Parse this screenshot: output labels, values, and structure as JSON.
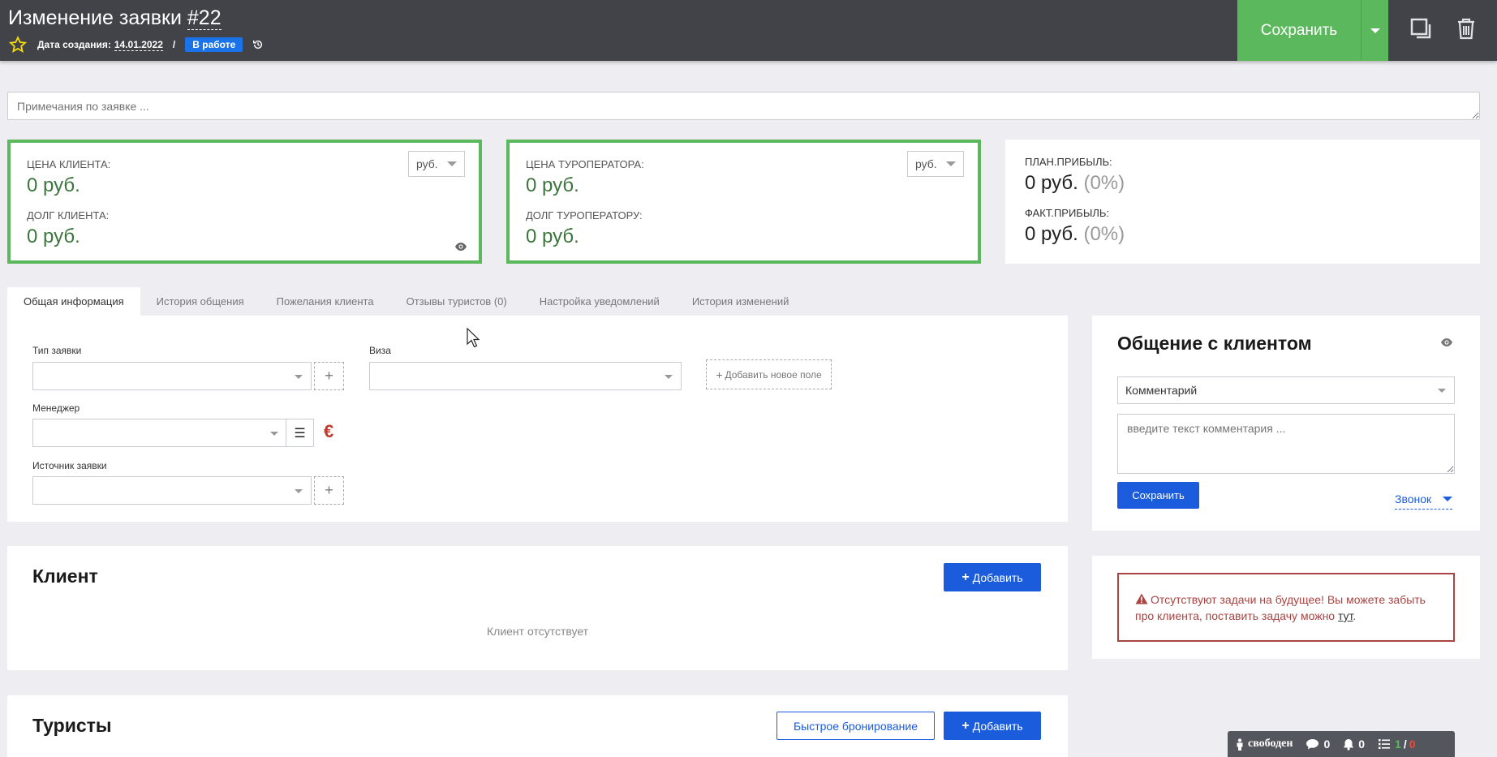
{
  "header": {
    "title_prefix": "Изменение заявки ",
    "title_number": "#22",
    "created_label": "Дата создания:",
    "created_date": "14.01.2022",
    "separator": "/",
    "status": "В работе",
    "save_label": "Сохранить",
    "save_color": "#5cb85c"
  },
  "notes": {
    "placeholder": "Примечания по заявке ..."
  },
  "prices": {
    "client_price_label": "ЦЕНА КЛИЕНТА:",
    "client_price_value": "0 руб.",
    "client_debt_label": "ДОЛГ КЛИЕНТА:",
    "client_debt_value": "0 руб.",
    "client_currency": "руб.",
    "operator_price_label": "ЦЕНА ТУРОПЕРАТОРА:",
    "operator_price_value": "0 руб.",
    "operator_debt_label": "ДОЛГ ТУРОПЕРАТОРУ:",
    "operator_debt_value": "0 руб.",
    "operator_currency": "руб.",
    "plan_label": "ПЛАН.ПРИБЫЛЬ:",
    "plan_value": "0 руб.",
    "plan_pct": "(0%)",
    "fact_label": "ФАКТ.ПРИБЫЛЬ:",
    "fact_value": "0 руб.",
    "fact_pct": "(0%)"
  },
  "tabs": [
    {
      "label": "Общая информация",
      "active": true
    },
    {
      "label": "История общения"
    },
    {
      "label": "Пожелания клиента"
    },
    {
      "label": "Отзывы туристов (0)"
    },
    {
      "label": "Настройка уведомлений"
    },
    {
      "label": "История изменений"
    }
  ],
  "general": {
    "type_label": "Тип заявки",
    "visa_label": "Виза",
    "add_field_label": "Добавить новое поле",
    "manager_label": "Менеджер",
    "source_label": "Источник заявки"
  },
  "client": {
    "title": "Клиент",
    "add_label": "Добавить",
    "empty": "Клиент отсутствует"
  },
  "tourists": {
    "title": "Туристы",
    "quick_booking_label": "Быстрое бронирование",
    "add_label": "Добавить"
  },
  "communication": {
    "title": "Общение с клиентом",
    "type_selected": "Комментарий",
    "comment_placeholder": "введите текст комментария ...",
    "save_label": "Сохранить",
    "call_label": "Звонок"
  },
  "alert": {
    "text": "Отсутствуют задачи на будущее! Вы можете забыть про клиента, поставить задачу можно ",
    "link": "тут",
    "end": "."
  },
  "statusbar": {
    "status": "свободен",
    "messages": "0",
    "notifications": "0",
    "tasks_done": "1",
    "tasks_sep": "/",
    "tasks_overdue": "0"
  }
}
